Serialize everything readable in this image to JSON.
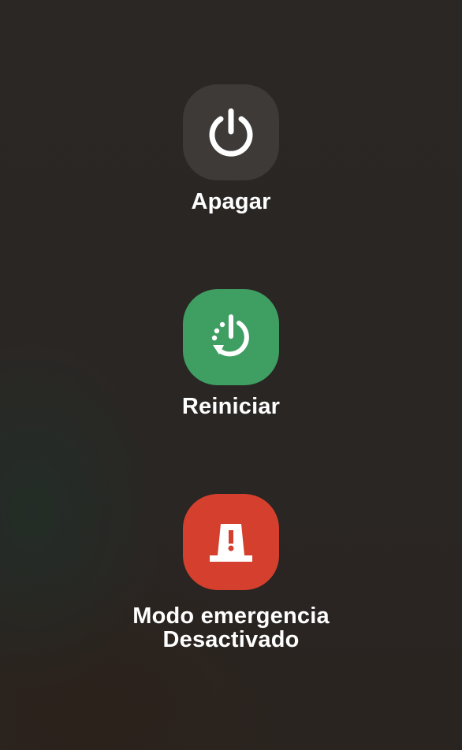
{
  "power_menu": {
    "power_off": {
      "label": "Apagar",
      "icon": "power-icon",
      "color": "#3d3a38"
    },
    "restart": {
      "label": "Reiniciar",
      "icon": "restart-icon",
      "color": "#3f9e62"
    },
    "emergency": {
      "label_line1": "Modo emergencia",
      "label_line2": "Desactivado",
      "icon": "emergency-alert-icon",
      "color": "#d4402d"
    }
  }
}
